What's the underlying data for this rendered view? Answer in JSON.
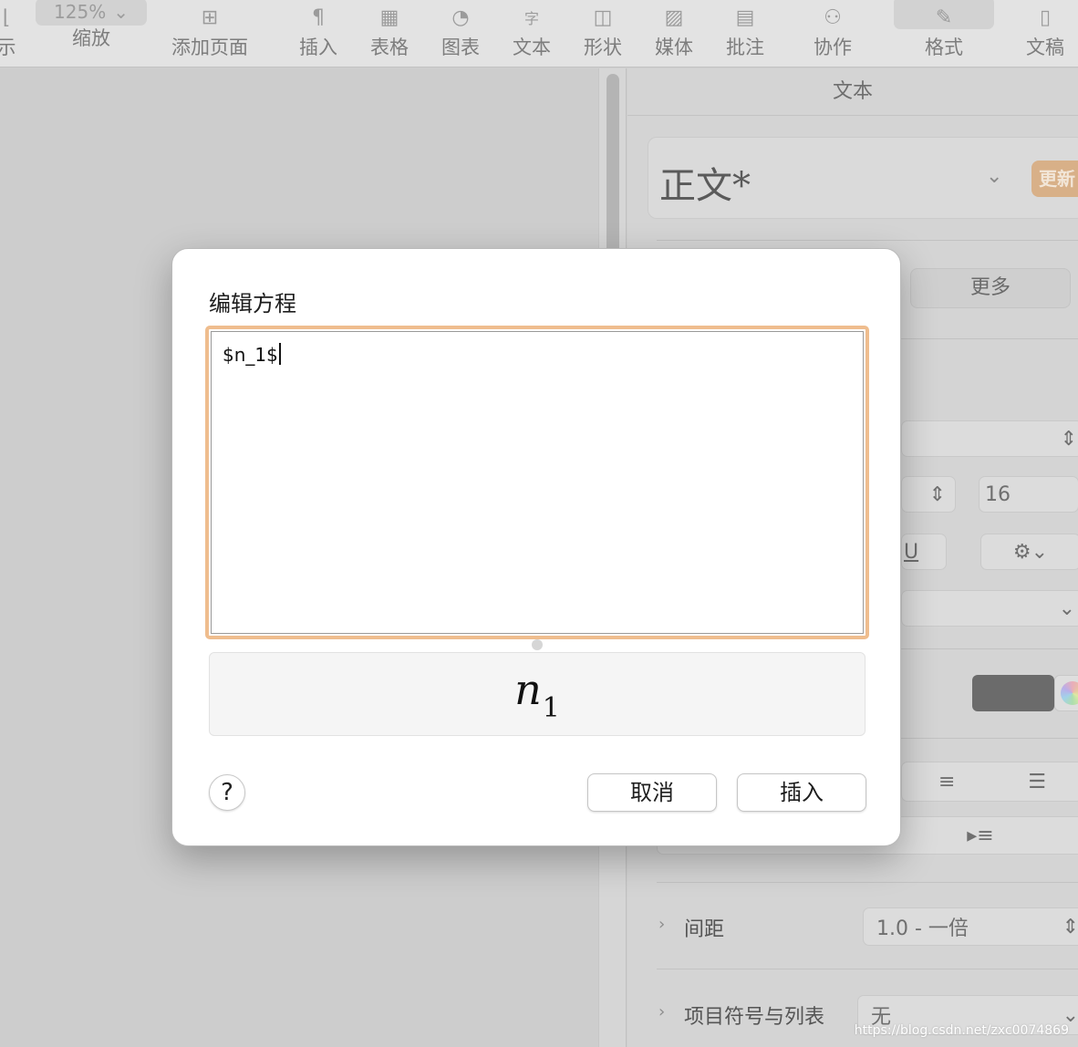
{
  "toolbar": {
    "partial_left_label": "示",
    "zoom_value": "125%",
    "zoom_label": "缩放",
    "items": [
      {
        "label": "添加页面",
        "icon": "add-page-icon",
        "glyph": "⊞"
      },
      {
        "label": "插入",
        "icon": "pilcrow-icon",
        "glyph": "¶"
      },
      {
        "label": "表格",
        "icon": "table-icon",
        "glyph": "▦"
      },
      {
        "label": "图表",
        "icon": "pie-chart-icon",
        "glyph": "◔"
      },
      {
        "label": "文本",
        "icon": "textbox-icon",
        "glyph": "字"
      },
      {
        "label": "形状",
        "icon": "shape-icon",
        "glyph": "◫"
      },
      {
        "label": "媒体",
        "icon": "media-icon",
        "glyph": "▨"
      },
      {
        "label": "批注",
        "icon": "comment-icon",
        "glyph": "▤"
      },
      {
        "label": "协作",
        "icon": "collaborate-icon",
        "glyph": "⚇"
      },
      {
        "label": "格式",
        "icon": "paintbrush-icon",
        "glyph": "✎"
      },
      {
        "label": "文稿",
        "icon": "document-icon",
        "glyph": "▯"
      }
    ]
  },
  "sidebar": {
    "title": "文本",
    "paragraph_style": "正文*",
    "update_label": "更新",
    "more_tab": "更多",
    "font_size": "16",
    "spacing_label": "间距",
    "spacing_value": "1.0 - 一倍",
    "bullets_label": "项目符号与列表",
    "bullets_value": "无"
  },
  "dialog": {
    "title": "编辑方程",
    "equation_source": "$n_1$",
    "preview_base": "n",
    "preview_subscript": "1",
    "help_label": "?",
    "cancel_label": "取消",
    "insert_label": "插入"
  },
  "watermark": "https://blog.csdn.net/zxc0074869",
  "colors": {
    "focus_ring": "#efbd8e",
    "update_button": "#d8b088",
    "dialog_background": "#ffffff",
    "dimmed_background": "#cfcfcf"
  }
}
